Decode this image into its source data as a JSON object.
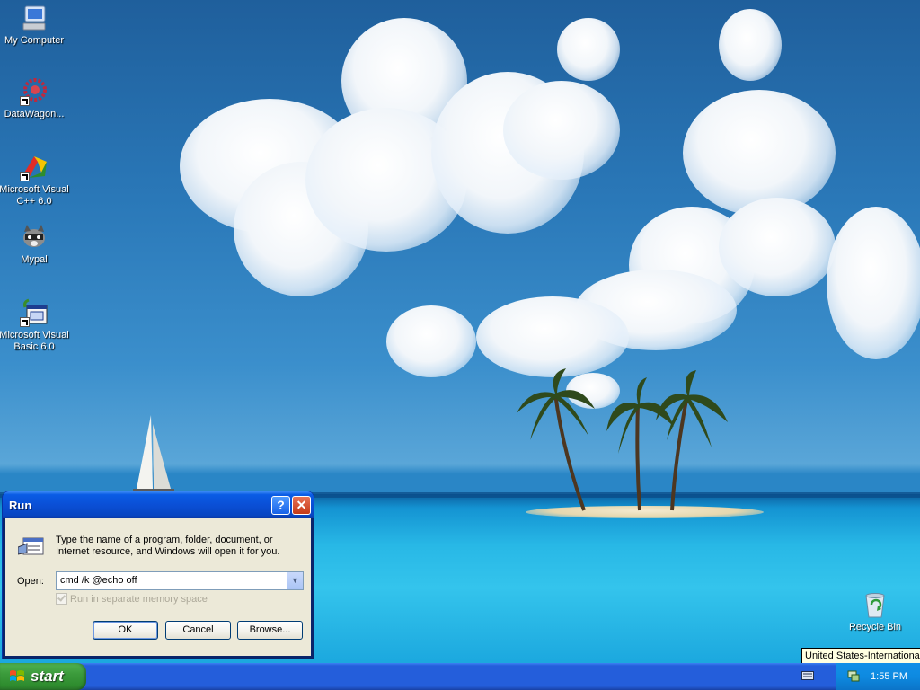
{
  "desktop": {
    "icons": [
      {
        "label": "My Computer"
      },
      {
        "label": "DataWagon..."
      },
      {
        "label": "Microsoft Visual C++ 6.0"
      },
      {
        "label": "Mypal"
      },
      {
        "label": "Microsoft Visual Basic 6.0"
      }
    ],
    "recycle_bin": {
      "label": "Recycle Bin"
    }
  },
  "run_dialog": {
    "title": "Run",
    "description": "Type the name of a program, folder, document, or Internet resource, and Windows will open it for you.",
    "open_label": "Open:",
    "open_value": "cmd /k @echo off",
    "checkbox_label": "Run in separate memory space",
    "checkbox_checked": true,
    "checkbox_enabled": false,
    "buttons": {
      "ok": "OK",
      "cancel": "Cancel",
      "browse": "Browse..."
    },
    "title_buttons": {
      "help": "?",
      "close": "✕"
    }
  },
  "taskbar": {
    "start_label": "start",
    "clock": "1:55 PM",
    "tooltip": "United States-International"
  }
}
